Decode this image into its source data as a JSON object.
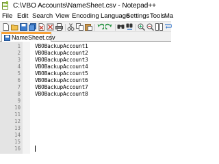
{
  "window": {
    "title": "C:\\VBO Accounts\\NameSheet.csv - Notepad++"
  },
  "menu": [
    "File",
    "Edit",
    "Search",
    "View",
    "Encoding",
    "Language",
    "Settings",
    "Tools",
    "Ma"
  ],
  "toolbar": {
    "buttons": [
      "new-icon",
      "open-icon",
      "save-icon",
      "save-all-icon",
      "close-icon",
      "close-all-icon",
      "print-icon",
      "cut-icon",
      "copy-icon",
      "paste-icon",
      "undo-icon",
      "redo-icon",
      "find-icon",
      "replace-icon",
      "zoom-in-icon",
      "zoom-out-icon",
      "sync-scroll-icon",
      "wrap-icon"
    ]
  },
  "tab": {
    "label": "NameSheet.csv"
  },
  "editor": {
    "line_numbers": [
      "1",
      "2",
      "3",
      "4",
      "5",
      "6",
      "7",
      "8",
      "9",
      "10",
      "11",
      "12",
      "13",
      "14",
      "15",
      "16"
    ],
    "lines": [
      "VBOBackupAccount1",
      "VBOBackupAccount2",
      "VBOBackupAccount3",
      "VBOBackupAccount4",
      "VBOBackupAccount5",
      "VBOBackupAccount6",
      "VBOBackupAccount7",
      "VBOBackupAccount8",
      "",
      "",
      "",
      "",
      "",
      "",
      "",
      ""
    ]
  },
  "colors": {
    "gutter": "#e4e4e4",
    "tab_accent": "#f7a035",
    "line_number_text": "#808080"
  }
}
